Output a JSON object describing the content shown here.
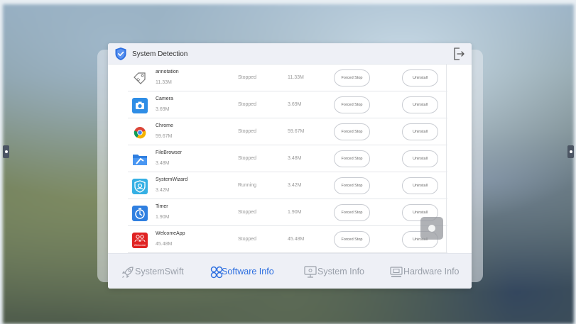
{
  "window": {
    "title": "System Detection"
  },
  "apps": [
    {
      "name": "annotation",
      "size_sub": "11.33M",
      "status": "Stopped",
      "size": "11.33M",
      "icon": "tag-icon"
    },
    {
      "name": "Camera",
      "size_sub": "3.69M",
      "status": "Stopped",
      "size": "3.69M",
      "icon": "camera-icon"
    },
    {
      "name": "Chrome",
      "size_sub": "59.67M",
      "status": "Stopped",
      "size": "59.67M",
      "icon": "chrome-icon"
    },
    {
      "name": "FileBrowser",
      "size_sub": "3.48M",
      "status": "Stopped",
      "size": "3.48M",
      "icon": "file-browser-icon"
    },
    {
      "name": "SystemWizard",
      "size_sub": "3.42M",
      "status": "Running",
      "size": "3.42M",
      "icon": "system-wizard-icon"
    },
    {
      "name": "Timer",
      "size_sub": "1.90M",
      "status": "Stopped",
      "size": "1.90M",
      "icon": "timer-icon"
    },
    {
      "name": "WelcomeApp",
      "size_sub": "45.48M",
      "status": "Stopped",
      "size": "45.48M",
      "icon": "welcome-app-icon",
      "icon_text": "Welcome"
    }
  ],
  "buttons": {
    "stop": "Forced Stop",
    "uninstall": "Uninstall"
  },
  "tabs": [
    {
      "label": "SystemSwift",
      "icon": "rocket-icon",
      "active": false
    },
    {
      "label": "Software Info",
      "icon": "apps-grid-icon",
      "active": true
    },
    {
      "label": "System Info",
      "icon": "monitor-icon",
      "active": false
    },
    {
      "label": "Hardware Info",
      "icon": "hardware-icon",
      "active": false
    }
  ],
  "colors": {
    "accent": "#2d6fe0",
    "inactive_tab": "#9aa0aa",
    "header_bg": "#eef0f6"
  }
}
